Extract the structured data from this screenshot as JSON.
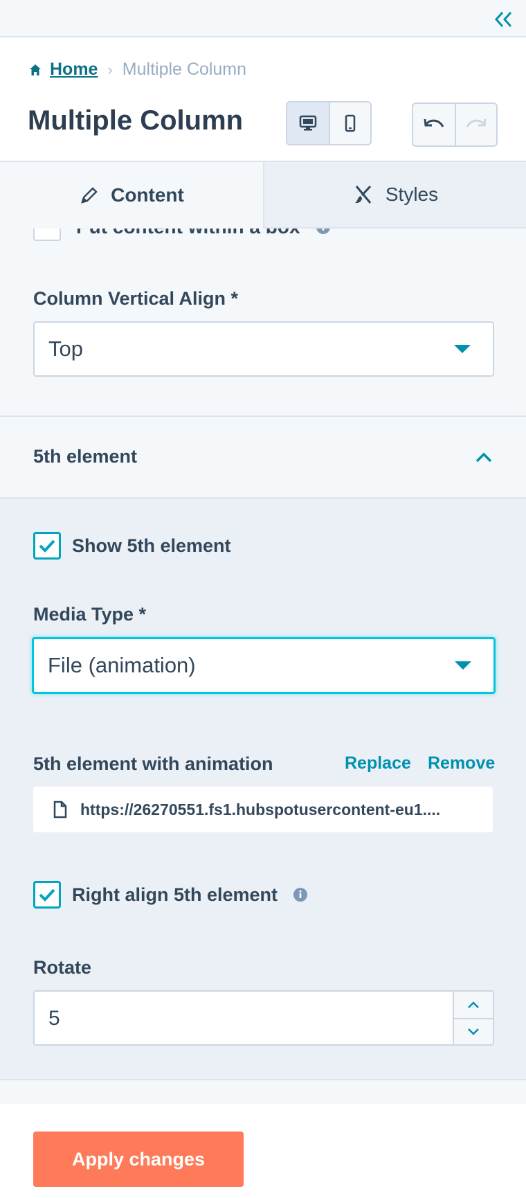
{
  "breadcrumb": {
    "home": "Home",
    "separator": "›",
    "current": "Multiple Column"
  },
  "header": {
    "title": "Multiple Column"
  },
  "tabs": {
    "content": "Content",
    "styles": "Styles"
  },
  "top_section": {
    "cut_checkbox_label": "Put content within a box",
    "vertical_align_label": "Column Vertical Align *",
    "vertical_align_value": "Top"
  },
  "element5": {
    "section_title": "5th element",
    "show_label": "Show 5th element",
    "show_checked": true,
    "media_type_label": "Media Type *",
    "media_type_value": "File (animation)",
    "animation_label": "5th element with animation",
    "replace": "Replace",
    "remove": "Remove",
    "file_url": "https://26270551.fs1.hubspotusercontent-eu1....",
    "right_align_label": "Right align 5th element",
    "right_align_checked": true,
    "rotate_label": "Rotate",
    "rotate_value": "5"
  },
  "footer": {
    "apply": "Apply changes"
  },
  "colors": {
    "accent": "#00a4bd",
    "link": "#0091ae",
    "apply": "#ff7a59"
  }
}
